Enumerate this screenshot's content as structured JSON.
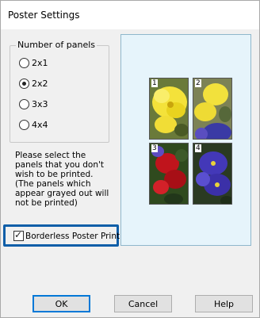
{
  "window": {
    "title": "Poster Settings"
  },
  "panels_group": {
    "legend": "Number of panels",
    "options": [
      {
        "label": "2x1",
        "checked": false
      },
      {
        "label": "2x2",
        "checked": true
      },
      {
        "label": "3x3",
        "checked": false
      },
      {
        "label": "4x4",
        "checked": false
      }
    ]
  },
  "note": "Please select the panels that you don't wish to be printed. (The panels which appear grayed out will not be printed)",
  "borderless": {
    "label": "Borderless Poster Print",
    "checked": true
  },
  "preview": {
    "panel_numbers": [
      "1",
      "2",
      "3",
      "4"
    ]
  },
  "buttons": {
    "ok": "OK",
    "cancel": "Cancel",
    "help": "Help"
  },
  "colors": {
    "highlight": "#0e5ea8",
    "preview_bg": "#e6f4fb"
  }
}
